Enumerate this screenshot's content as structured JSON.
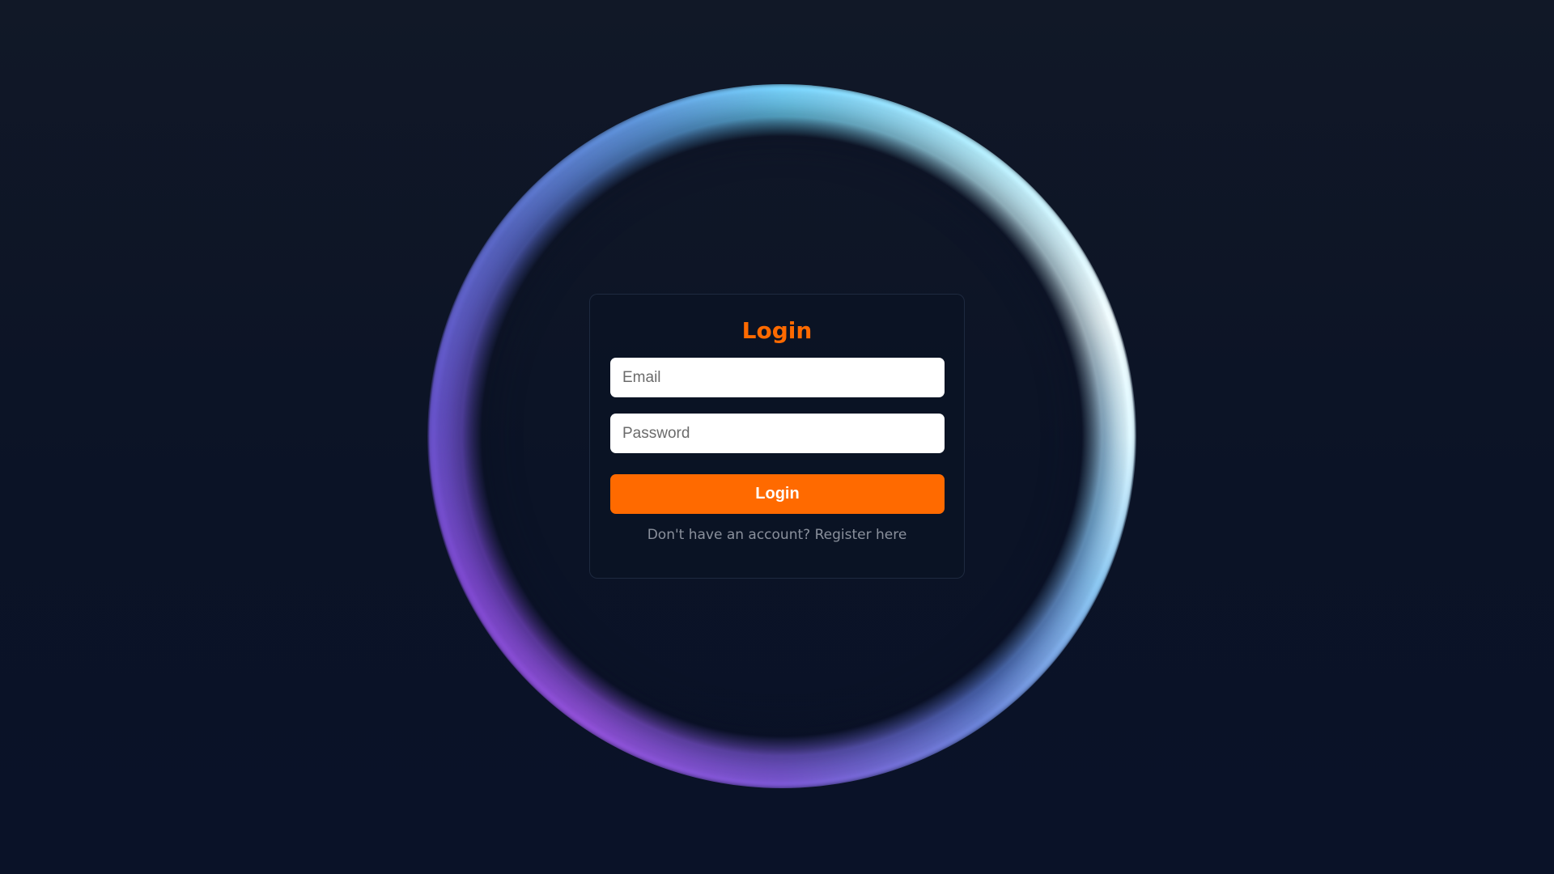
{
  "login": {
    "title": "Login",
    "email": {
      "placeholder": "Email",
      "value": ""
    },
    "password": {
      "placeholder": "Password",
      "value": ""
    },
    "submit_label": "Login",
    "register_prompt": "Don't have an account?",
    "register_link": "Register here"
  },
  "colors": {
    "accent": "#ff6a00",
    "background": "#0b1326",
    "ring_cool": "#b6f0ff",
    "ring_warm": "#9150d8"
  }
}
